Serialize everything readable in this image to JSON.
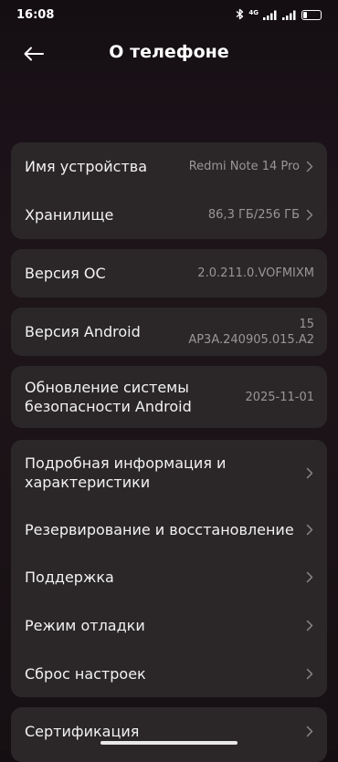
{
  "status_bar": {
    "time": "16:08",
    "network": "4G",
    "battery": "22",
    "battery_level_percent": 22,
    "icons": [
      "bluetooth-icon",
      "signal-icon",
      "signal-icon",
      "battery-icon"
    ]
  },
  "header": {
    "title": "О телефоне",
    "back_icon": "arrow-left-icon"
  },
  "device_card": {
    "name_label": "Имя устройства",
    "name_value": "Redmi Note 14 Pro",
    "storage_label": "Хранилище",
    "storage_value": "86,3 ГБ/256 ГБ"
  },
  "os_card": {
    "label": "Версия ОС",
    "value": "2.0.211.0.VOFMIXM"
  },
  "android_card": {
    "label": "Версия Android",
    "value_line1": "15",
    "value_line2": "AP3A.240905.015.A2"
  },
  "security_card": {
    "label_line1": "Обновление системы",
    "label_line2": "безопасности Android",
    "value": "2025-11-01"
  },
  "menu_card": {
    "items": [
      {
        "label_line1": "Подробная информация и",
        "label_line2": "характеристики"
      },
      {
        "label": "Резервирование и восстановление"
      },
      {
        "label": "Поддержка"
      },
      {
        "label": "Режим отладки"
      },
      {
        "label": "Сброс настроек"
      }
    ]
  },
  "cert_card": {
    "label": "Сертификация"
  },
  "colors": {
    "background": "#1a1216",
    "card": "#2b2729",
    "secondary_text": "#9a9597"
  }
}
